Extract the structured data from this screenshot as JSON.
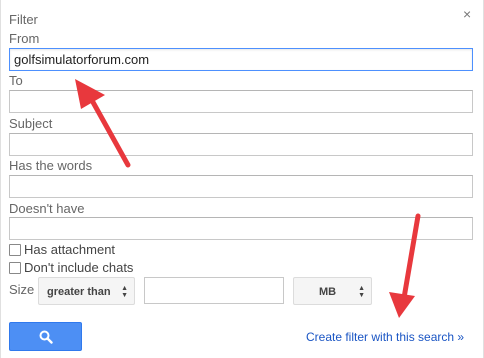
{
  "dialog": {
    "title": "Filter",
    "close_label": "×"
  },
  "fields": {
    "from_label": "From",
    "from_value": "golfsimulatorforum.com",
    "to_label": "To",
    "to_value": "",
    "subject_label": "Subject",
    "subject_value": "",
    "has_words_label": "Has the words",
    "has_words_value": "",
    "doesnt_have_label": "Doesn't have",
    "doesnt_have_value": ""
  },
  "options": {
    "has_attachment_label": "Has attachment",
    "has_attachment_checked": false,
    "dont_include_chats_label": "Don't include chats",
    "dont_include_chats_checked": false
  },
  "size": {
    "label": "Size",
    "operator_selected": "greater than",
    "value": "",
    "unit_selected": "MB"
  },
  "actions": {
    "search_icon": "search-icon",
    "create_filter_label": "Create filter with this search »"
  },
  "annotation": {
    "arrow_color": "#e8383d"
  }
}
